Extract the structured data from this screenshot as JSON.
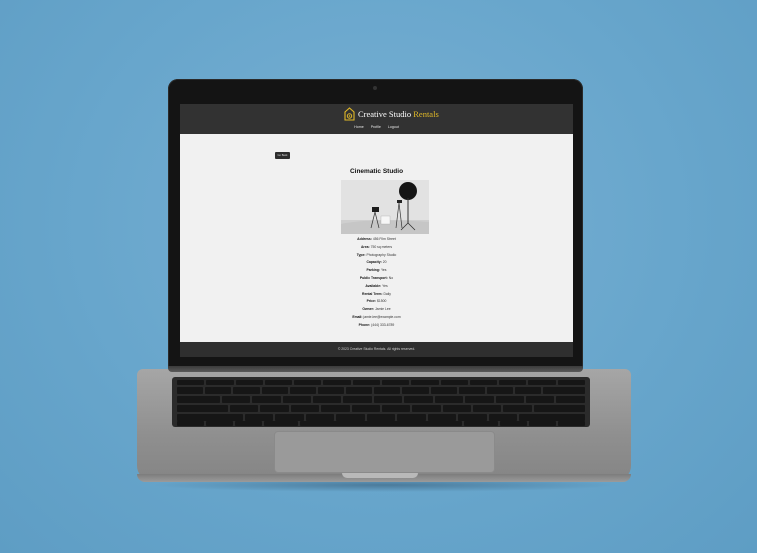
{
  "site": {
    "brand_part1": "Creative Studio",
    "brand_part2": "Rentals",
    "nav": [
      "Home",
      "Profile",
      "Logout"
    ],
    "back_label": "Go Back",
    "footer": "© 2023 Creative Studio Rentals. All rights reserved."
  },
  "listing": {
    "title": "Cinematic Studio",
    "details": [
      {
        "label": "Address:",
        "value": "456 Film Street"
      },
      {
        "label": "Area:",
        "value": "750 sq meters"
      },
      {
        "label": "Type:",
        "value": "Photography Studio"
      },
      {
        "label": "Capacity:",
        "value": "20"
      },
      {
        "label": "Parking:",
        "value": "Yes"
      },
      {
        "label": "Public Transport:",
        "value": "No"
      },
      {
        "label": "Available:",
        "value": "Yes"
      },
      {
        "label": "Rental Term:",
        "value": "Daily"
      },
      {
        "label": "Price:",
        "value": "$1500"
      },
      {
        "label": "Owner:",
        "value": "Jamie Lee"
      },
      {
        "label": "Email:",
        "value": "jamie.lee@example.com"
      },
      {
        "label": "Phone:",
        "value": "(444) 333-6789"
      }
    ]
  },
  "colors": {
    "header_bg": "#323232",
    "brand_accent": "#e1b928",
    "page_bg": "#f1f1f1",
    "desk_bg": "#68a6cc"
  }
}
